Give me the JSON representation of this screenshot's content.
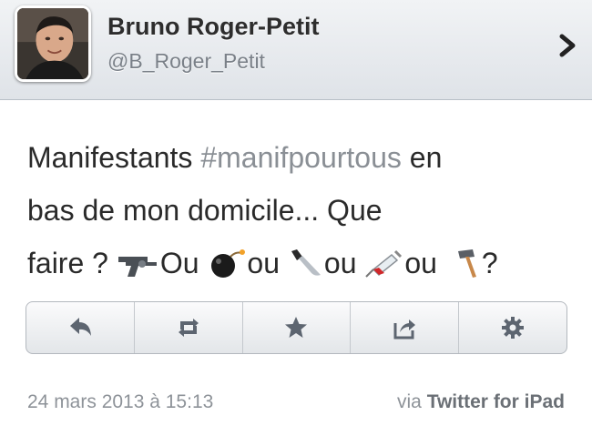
{
  "header": {
    "display_name": "Bruno Roger-Petit",
    "handle": "@B_Roger_Petit"
  },
  "tweet": {
    "line1_pre": "Manifestants ",
    "hashtag": "#manifpourtous",
    "line1_post": " en",
    "line2": "bas de mon domicile... Que",
    "line3_a": "faire ? ",
    "line3_b": "Ou ",
    "line3_c": "ou ",
    "line3_d": "ou ",
    "line3_e": "ou ",
    "line3_f": "?"
  },
  "actions": [
    "reply-icon",
    "retweet-icon",
    "favorite-icon",
    "share-icon",
    "settings-icon"
  ],
  "footer": {
    "timestamp": "24 mars 2013 à 15:13",
    "via_prefix": "via ",
    "via_app": "Twitter for iPad"
  },
  "colors": {
    "text": "#2a2a2a",
    "hashtag": "#8a8f95",
    "icon": "#5d6570",
    "meta": "#8e9399"
  }
}
